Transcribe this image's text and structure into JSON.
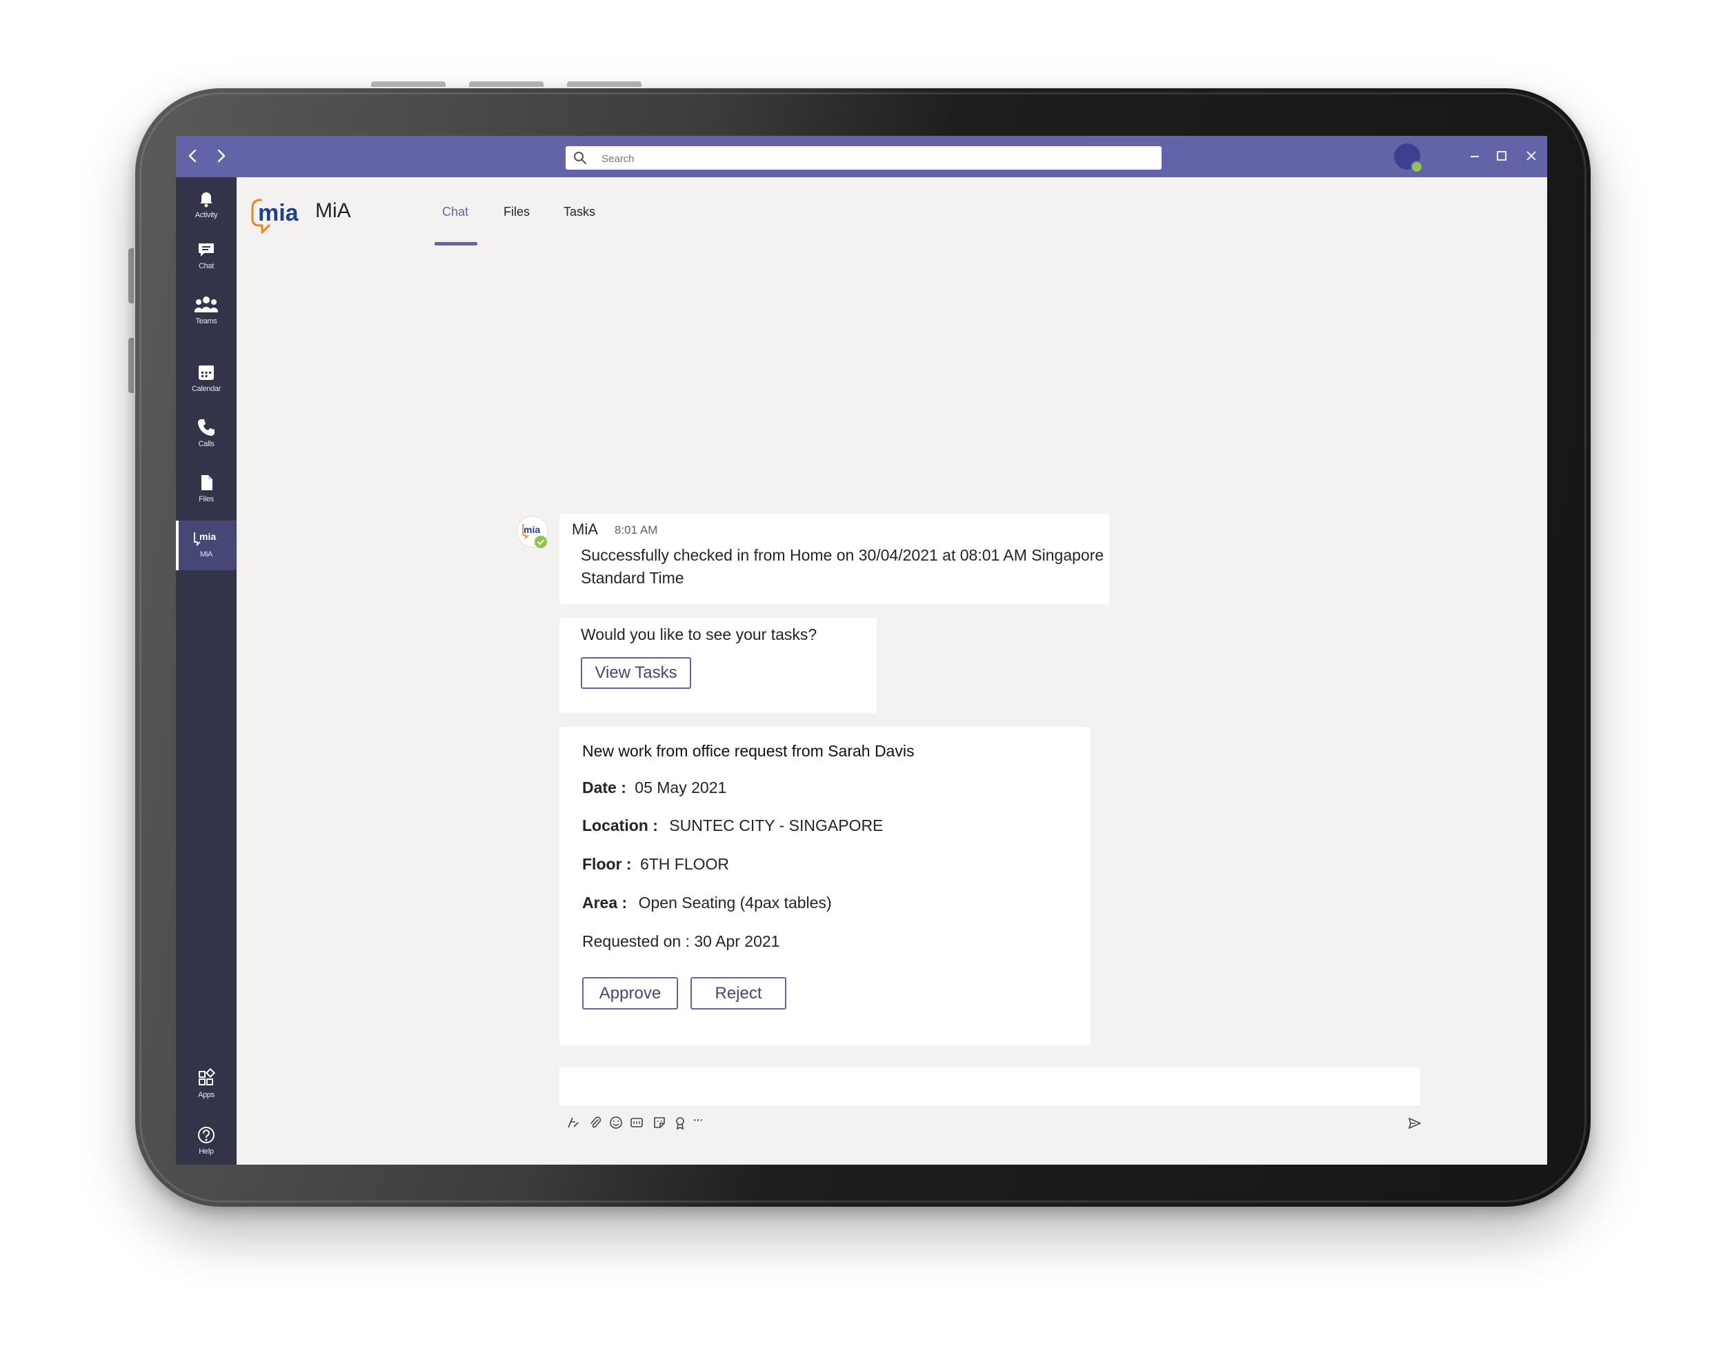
{
  "titlebar": {
    "search_placeholder": "Search"
  },
  "rail": {
    "items": [
      {
        "label": "Activity",
        "icon": "bell-icon"
      },
      {
        "label": "Chat",
        "icon": "chat-icon"
      },
      {
        "label": "Teams",
        "icon": "teams-icon"
      },
      {
        "label": "Calendar",
        "icon": "calendar-icon"
      },
      {
        "label": "Calls",
        "icon": "phone-icon"
      },
      {
        "label": "Files",
        "icon": "file-icon"
      },
      {
        "label": "MiA",
        "icon": "mia-icon"
      }
    ],
    "bottom": [
      {
        "label": "Apps",
        "icon": "apps-icon"
      },
      {
        "label": "Help",
        "icon": "help-icon"
      }
    ]
  },
  "app": {
    "logo_text": "mia",
    "title": "MiA",
    "tabs": [
      {
        "label": "Chat",
        "active": true
      },
      {
        "label": "Files",
        "active": false
      },
      {
        "label": "Tasks",
        "active": false
      }
    ]
  },
  "message": {
    "avatar_text": "mia",
    "sender": "MiA",
    "time": "8:01 AM",
    "text": "Successfully checked in from Home on 30/04/2021 at 08:01 AM Singapore Standard Time"
  },
  "tasks_card": {
    "question": "Would you like to see your tasks?",
    "button_label": "View Tasks"
  },
  "request_card": {
    "title": "New work from office request from Sarah Davis",
    "date_label": "Date :",
    "date_value": "05 May 2021",
    "location_label": "Location :",
    "location_value": "SUNTEC CITY - SINGAPORE",
    "floor_label": "Floor :",
    "floor_value": "6TH FLOOR",
    "area_label": "Area :",
    "area_value": "Open Seating (4pax tables)",
    "requested_on": "Requested on : 30 Apr 2021",
    "approve_label": "Approve",
    "reject_label": "Reject"
  },
  "compose": {
    "tools": [
      "format-icon",
      "attach-icon",
      "emoji-icon",
      "gif-icon",
      "sticker-icon",
      "praise-icon",
      "more-icon"
    ],
    "more_label": "···"
  },
  "colors": {
    "brand": "#6264a7",
    "rail": "#33344a",
    "presence": "#92c353"
  }
}
